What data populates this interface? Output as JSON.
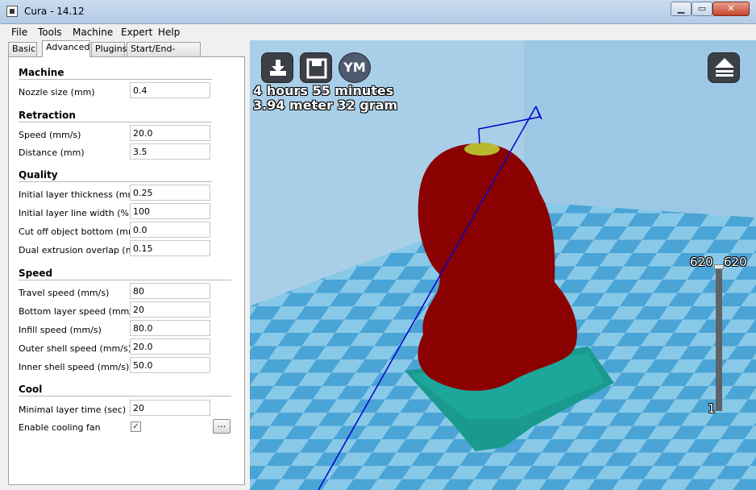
{
  "window": {
    "title": "Cura - 14.12",
    "min_label": "▁",
    "max_label": "▭",
    "close_label": "✕"
  },
  "menu": [
    {
      "label": "File"
    },
    {
      "label": "Tools"
    },
    {
      "label": "Machine"
    },
    {
      "label": "Expert"
    },
    {
      "label": "Help"
    }
  ],
  "tabs": [
    {
      "label": "Basic"
    },
    {
      "label": "Advanced"
    },
    {
      "label": "Plugins"
    },
    {
      "label": "Start/End-GCode"
    }
  ],
  "active_tab": "Advanced",
  "sections": {
    "machine": {
      "title": "Machine",
      "fields": [
        {
          "label": "Nozzle size (mm)",
          "value": "0.4"
        }
      ]
    },
    "retraction": {
      "title": "Retraction",
      "fields": [
        {
          "label": "Speed (mm/s)",
          "value": "20.0"
        },
        {
          "label": "Distance (mm)",
          "value": "3.5"
        }
      ]
    },
    "quality": {
      "title": "Quality",
      "fields": [
        {
          "label": "Initial layer thickness (mm)",
          "value": "0.25"
        },
        {
          "label": "Initial layer line width (%)",
          "value": "100"
        },
        {
          "label": "Cut off object bottom (mm)",
          "value": "0.0"
        },
        {
          "label": "Dual extrusion overlap (mm)",
          "value": "0.15"
        }
      ]
    },
    "speed": {
      "title": "Speed",
      "fields": [
        {
          "label": "Travel speed (mm/s)",
          "value": "80"
        },
        {
          "label": "Bottom layer speed (mm/s)",
          "value": "20"
        },
        {
          "label": "Infill speed (mm/s)",
          "value": "80.0"
        },
        {
          "label": "Outer shell speed (mm/s)",
          "value": "20.0"
        },
        {
          "label": "Inner shell speed (mm/s)",
          "value": "50.0"
        }
      ]
    },
    "cool": {
      "title": "Cool",
      "fields": [
        {
          "label": "Minimal layer time (sec)",
          "value": "20"
        }
      ],
      "fan_label": "Enable cooling fan",
      "fan_checked": true,
      "fan_check_glyph": "✓",
      "more_button": "..."
    }
  },
  "viewport": {
    "print_time": "4 hours 55 minutes",
    "print_material": "3.94 meter 32 gram",
    "ym_button": "YM",
    "layer_top_left": "620",
    "layer_top_right": "620",
    "layer_bottom": "1",
    "colors": {
      "floor_light": "#89c9e8",
      "floor_dark": "#4aa4d6",
      "model_outer": "#8b0000",
      "model_support": "#1a9a8f",
      "travel_line": "#0000cc"
    }
  }
}
